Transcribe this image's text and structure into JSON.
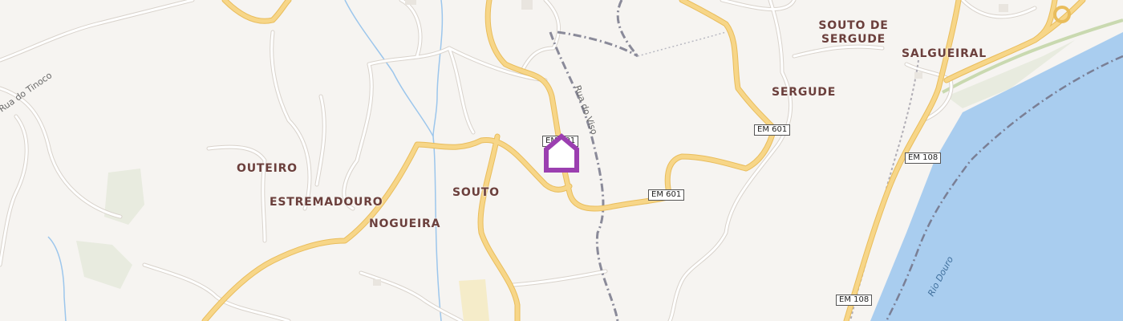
{
  "places": {
    "outeiro": "OUTEIRO",
    "estremadouro": "ESTREMADOURO",
    "nogueira": "NOGUEIRA",
    "souto": "SOUTO",
    "sergude": "SERGUDE",
    "souto_de_sergude_line1": "SOUTO DE",
    "souto_de_sergude_line2": "SERGUDE",
    "salgueiral": "SALGUEIRAL"
  },
  "roads": {
    "em601_a": "EM 601",
    "em601_b": "EM 601",
    "em601_c": "EM 601",
    "em108_a": "EM 108",
    "em108_b": "EM 108"
  },
  "streets": {
    "rua_do_tinoco": "Rua do Tinoco",
    "rua_do_viso": "Rua do Viso"
  },
  "water": {
    "river": "Rio Douro"
  },
  "marker": {
    "icon": "home-marker-icon",
    "color": "#9b3fb0"
  },
  "colors": {
    "background": "#f6f4f1",
    "major_road": "#f7d688",
    "major_road_casing": "#e9bd5c",
    "minor_road": "#ffffff",
    "minor_road_casing": "#d9d3cc",
    "water": "#a9cdef",
    "stream": "#9cc6ec",
    "railway": "#8a8a99",
    "label": "#6b3f3c"
  }
}
